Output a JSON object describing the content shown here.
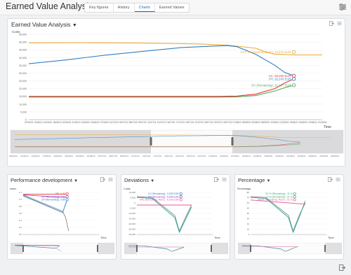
{
  "header": {
    "title": "Earned Value Analysis",
    "tabs": [
      {
        "label": "Key figures",
        "active": false
      },
      {
        "label": "History",
        "active": false
      },
      {
        "label": "Charts",
        "active": true
      },
      {
        "label": "Earned Values",
        "active": false
      }
    ]
  },
  "colors": {
    "blue": "#2f7fc3",
    "orange": "#f1a833",
    "red": "#e53935",
    "green": "#58a65c",
    "purple": "#9b45c2",
    "teal": "#27a99b",
    "pink": "#e8579a",
    "grey": "#888888"
  },
  "main_chart": {
    "title": "Earned Value Analysis",
    "icons": [
      "export-icon",
      "settings-icon"
    ],
    "chart_data": {
      "type": "line",
      "ylabel": "Costs",
      "xlabel": "Time",
      "ylim": [
        0,
        55000
      ],
      "yticks": [
        "0",
        "5,000",
        "10,000",
        "15,000",
        "20,000",
        "25,000",
        "30,000",
        "35,000",
        "40,000",
        "45,000",
        "50,000",
        "55,000"
      ],
      "xticks": [
        "12/06/24",
        "13/06/24",
        "14/06/24",
        "18/06/24",
        "20/06/24",
        "21/06/24",
        "24/06/24",
        "26/06/24",
        "27/06/24",
        "01/07/24",
        "03/07/24",
        "08/07/24",
        "09/07/24",
        "11/07/24",
        "12/07/24",
        "15/07/24",
        "17/07/24",
        "19/07/24",
        "22/07/24",
        "26/07/24",
        "29/07/24",
        "30/07/24",
        "01/08/24",
        "05/08/24",
        "06/08/24",
        "08/08/24",
        "10/08/24",
        "12/08/24",
        "15/08/24",
        "18/08/24",
        "19/08/24",
        "21/08/24"
      ],
      "series": [
        {
          "name": "EAC (Remaining, Real.)",
          "color": "#f1a833",
          "values": [
            [
              0,
              49500
            ],
            [
              6,
              49600
            ],
            [
              12,
              49400
            ],
            [
              18,
              48800
            ],
            [
              21,
              48000
            ],
            [
              24,
              46000
            ],
            [
              25,
              43572
            ],
            [
              26,
              42200
            ],
            [
              28,
              41700
            ],
            [
              31,
              41700
            ]
          ]
        },
        {
          "name": "AC",
          "color": "#2f7fc3",
          "values": [
            [
              0,
              36000
            ],
            [
              4,
              38500
            ],
            [
              8,
              41500
            ],
            [
              12,
              44000
            ],
            [
              16,
              46400
            ],
            [
              20,
              47500
            ],
            [
              21,
              47700
            ],
            [
              22,
              47000
            ],
            [
              24,
              42000
            ],
            [
              26,
              35000
            ],
            [
              27,
              30500
            ],
            [
              28,
              28250
            ]
          ]
        },
        {
          "name": "PV",
          "color": "#e53935",
          "values": [
            [
              0,
              15000
            ],
            [
              20,
              15000
            ],
            [
              22,
              15200
            ],
            [
              24,
              16500
            ],
            [
              26,
              20000
            ],
            [
              27,
              23500
            ],
            [
              28,
              26243
            ]
          ]
        },
        {
          "name": "EV",
          "color": "#58a65c",
          "values": [
            [
              0,
              14500
            ],
            [
              20,
              14500
            ],
            [
              22,
              14700
            ],
            [
              24,
              15600
            ],
            [
              26,
              18500
            ],
            [
              27,
              20500
            ],
            [
              28,
              22187
            ]
          ]
        }
      ],
      "annotations": [
        {
          "text": "EAC (Remaining, Real.): 43,572 EUR",
          "color": "#f1a833",
          "value": 43572
        },
        {
          "text": "AC: 28,250 EUR",
          "color": "#e53935",
          "value": 28250
        },
        {
          "text": "PV: 26,243 EUR",
          "color": "#2f7fc3",
          "value": 26243
        },
        {
          "text": "EV (Remaining): 22,187 EUR",
          "color": "#58a65c",
          "value": 22187
        }
      ],
      "nav_xticks": [
        "08/06/24",
        "11/06/24",
        "14/06/24",
        "17/06/24",
        "20/06/24",
        "23/06/24",
        "26/06/24",
        "29/06/24",
        "02/07/24",
        "05/07/24",
        "08/07/24",
        "11/07/24",
        "14/07/24",
        "17/07/24",
        "20/07/24",
        "23/07/24",
        "26/07/24",
        "29/07/24",
        "01/08/24",
        "04/08/24",
        "07/08/24",
        "10/08/24",
        "13/08/24",
        "16/08/24",
        "19/08/24",
        "22/08/24",
        "25/08/24",
        "28/08/24",
        "31/08/24",
        "03/09/24"
      ]
    }
  },
  "small_charts": [
    {
      "title": "Performance development",
      "ylabel": "Index",
      "xlabel": "Time",
      "yticks": [
        "1.2",
        "1.0",
        "0.8",
        "0.6",
        "0.4",
        "0.2",
        "0.0"
      ],
      "annotations": [
        {
          "text": "API: 1.00",
          "color": "#e53935"
        },
        {
          "text": "SPI (Remaining): 0.85",
          "color": "#9b45c2"
        },
        {
          "text": "CPI (Remaining): 0.85",
          "color": "#2f7fc3"
        }
      ]
    },
    {
      "title": "Deviations",
      "ylabel": "Costs",
      "xlabel": "Time",
      "yticks": [
        "10,000",
        "5,000",
        "0",
        "-5,000",
        "-10,000",
        "-15,000",
        "-20,000",
        "-25,000",
        "-30,000"
      ],
      "annotations": [
        {
          "text": "CV (Remaining): -3,025 EUR",
          "color": "#2f7fc3"
        },
        {
          "text": "SV (Remaining): -5,096 EUR",
          "color": "#9b45c2"
        },
        {
          "text": "VAC (Remaining, Real.): -6,150 EUR",
          "color": "#e8579a"
        }
      ]
    },
    {
      "title": "Percentage",
      "ylabel": "Percentage",
      "xlabel": "Time",
      "yticks": [
        "80",
        "70",
        "60",
        "50",
        "40",
        "30",
        "20",
        "10",
        "0"
      ],
      "annotations": [
        {
          "text": "SV % (Remaining): -11 %",
          "color": "#27a99b"
        },
        {
          "text": "CV% (Remaining): -21 %",
          "color": "#58a65c"
        },
        {
          "text": "VAC% (Remaining, Real.): -21 %",
          "color": "#e8579a"
        }
      ]
    }
  ]
}
